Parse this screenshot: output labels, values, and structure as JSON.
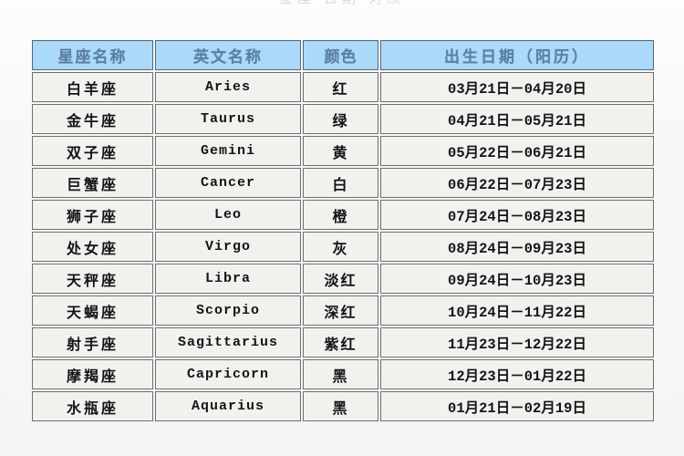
{
  "page": {
    "top_clipped_text": "星座 日期 对照"
  },
  "table": {
    "columns": [
      {
        "key": "name",
        "label": "星座名称"
      },
      {
        "key": "en",
        "label": "英文名称"
      },
      {
        "key": "color",
        "label": "颜色"
      },
      {
        "key": "date",
        "label": "出生日期（阳历）"
      }
    ],
    "rows": [
      {
        "name": "白羊座",
        "en": "Aries",
        "color": "红",
        "date": "03月21日－04月20日"
      },
      {
        "name": "金牛座",
        "en": "Taurus",
        "color": "绿",
        "date": "04月21日－05月21日"
      },
      {
        "name": "双子座",
        "en": "Gemini",
        "color": "黄",
        "date": "05月22日－06月21日"
      },
      {
        "name": "巨蟹座",
        "en": "Cancer",
        "color": "白",
        "date": "06月22日－07月23日"
      },
      {
        "name": "狮子座",
        "en": "Leo",
        "color": "橙",
        "date": "07月24日－08月23日"
      },
      {
        "name": "处女座",
        "en": "Virgo",
        "color": "灰",
        "date": "08月24日－09月23日"
      },
      {
        "name": "天秤座",
        "en": "Libra",
        "color": "淡红",
        "date": "09月24日－10月23日"
      },
      {
        "name": "天蝎座",
        "en": "Scorpio",
        "color": "深红",
        "date": "10月24日－11月22日"
      },
      {
        "name": "射手座",
        "en": "Sagittarius",
        "color": "紫红",
        "date": "11月23日－12月22日"
      },
      {
        "name": "摩羯座",
        "en": "Capricorn",
        "color": "黑",
        "date": "12月23日－01月22日"
      },
      {
        "name": "水瓶座",
        "en": "Aquarius",
        "color": "黑",
        "date": "01月21日－02月19日"
      }
    ]
  },
  "colors": {
    "header_fill": "#a9d6f4",
    "header_text": "#5f7f9e",
    "header_border": "#54687c",
    "cell_fill": "#edeeea",
    "cell_text": "#17181a",
    "cell_border": "#6f6f6f",
    "page_background": "#f6f7f7"
  }
}
